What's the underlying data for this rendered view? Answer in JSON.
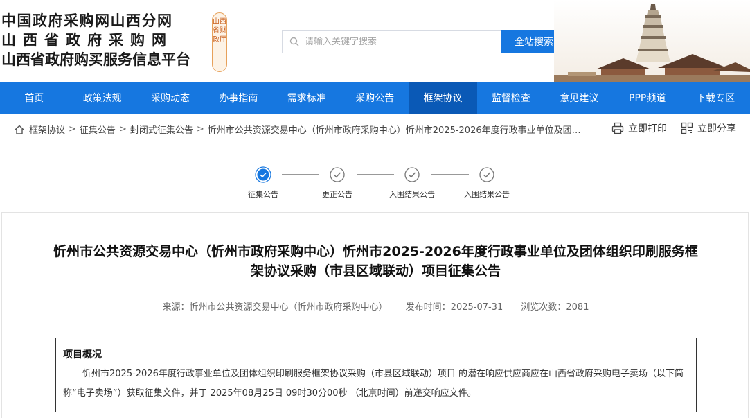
{
  "header": {
    "title_line1": "中国政府采购网山西分网",
    "title_line2": "山西省政府采购网",
    "title_line3": "山西省政府购买服务信息平台",
    "seal_text": "山西省财政厅",
    "search_placeholder": "请输入关键字搜索",
    "search_button": "全站搜索"
  },
  "nav": {
    "items": [
      {
        "label": "首页"
      },
      {
        "label": "政策法规"
      },
      {
        "label": "采购动态"
      },
      {
        "label": "办事指南"
      },
      {
        "label": "需求标准"
      },
      {
        "label": "采购公告"
      },
      {
        "label": "框架协议"
      },
      {
        "label": "监督检查"
      },
      {
        "label": "意见建议"
      },
      {
        "label": "PPP频道"
      },
      {
        "label": "下载专区"
      }
    ],
    "active_index": 6,
    "color": "#1677e0",
    "active_color": "#0a59b6"
  },
  "breadcrumb": {
    "items": [
      "框架协议",
      "征集公告",
      "封闭式征集公告"
    ],
    "current": "忻州市公共资源交易中心（忻州市政府采购中心）忻州市2025-2026年度行政事业单位及团体组..."
  },
  "tools": {
    "print_label": "立即打印",
    "share_label": "立即分享"
  },
  "steps": [
    {
      "label": "征集公告",
      "status": "active"
    },
    {
      "label": "更正公告",
      "status": "done"
    },
    {
      "label": "入围结果公告",
      "status": "done"
    },
    {
      "label": "入围结果公告",
      "status": "done"
    }
  ],
  "article": {
    "title": "忻州市公共资源交易中心（忻州市政府采购中心）忻州市2025-2026年度行政事业单位及团体组织印刷服务框架协议采购（市县区域联动）项目征集公告",
    "source": "来源：忻州市公共资源交易中心（忻州市政府采购中心）",
    "publish_time": "发布时间：2025-07-31",
    "views": "浏览次数：2081",
    "overview_heading": "项目概况",
    "overview_text": "忻州市2025-2026年度行政事业单位及团体组织印刷服务框架协议采购（市县区域联动）项目 的潜在响应供应商应在山西省政府采购电子卖场（以下简称“电子卖场”）获取征集文件，并于 2025年08月25日 09时30分00秒 （北京时间）前递交响应文件。"
  }
}
